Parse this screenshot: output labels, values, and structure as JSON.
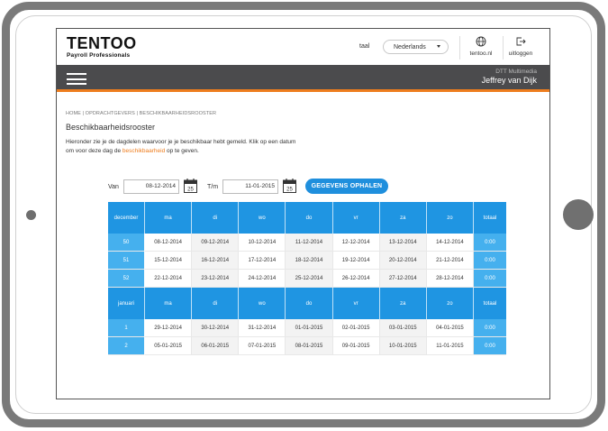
{
  "header": {
    "logo_main": "TENTOO",
    "logo_sub": "Payroll Professionals",
    "language_label": "taal",
    "language_value": "Nederlands",
    "site_link_label": "tentoo.nl",
    "logout_label": "uitloggen"
  },
  "navbar": {
    "company": "DTT Multimedia",
    "user": "Jeffrey van Dijk"
  },
  "breadcrumb": "HOME | OPDRACHTGEVERS | BESCHIKBAARHEIDSROOSTER",
  "page_title": "Beschikbaarheidsrooster",
  "intro": {
    "text_before": "Hieronder zie je de dagdelen waarvoor je je beschikbaar hebt gemeld. Klik op een datum om voor deze dag de ",
    "link": "beschikbaarheid",
    "text_after": " op te geven."
  },
  "filter": {
    "from_label": "Van",
    "from_value": "08-12-2014",
    "to_label": "T/m",
    "to_value": "11-01-2015",
    "calendar_day": "25",
    "fetch_button": "GEGEVENS OPHALEN"
  },
  "colors": {
    "accent_blue": "#1f95e2",
    "cell_blue": "#45b0ee",
    "orange": "#ee7d1e",
    "navbar": "#4b4b4d"
  },
  "months": [
    {
      "name": "december",
      "days": [
        "ma",
        "di",
        "wo",
        "do",
        "vr",
        "za",
        "zo"
      ],
      "total_label": "totaal",
      "weeks": [
        {
          "week": "50",
          "dates": [
            "08-12-2014",
            "09-12-2014",
            "10-12-2014",
            "11-12-2014",
            "12-12-2014",
            "13-12-2014",
            "14-12-2014"
          ],
          "total": "0:00"
        },
        {
          "week": "51",
          "dates": [
            "15-12-2014",
            "16-12-2014",
            "17-12-2014",
            "18-12-2014",
            "19-12-2014",
            "20-12-2014",
            "21-12-2014"
          ],
          "total": "0:00"
        },
        {
          "week": "52",
          "dates": [
            "22-12-2014",
            "23-12-2014",
            "24-12-2014",
            "25-12-2014",
            "26-12-2014",
            "27-12-2014",
            "28-12-2014"
          ],
          "total": "0:00"
        }
      ]
    },
    {
      "name": "januari",
      "days": [
        "ma",
        "di",
        "wo",
        "do",
        "vr",
        "za",
        "zo"
      ],
      "total_label": "totaal",
      "weeks": [
        {
          "week": "1",
          "dates": [
            "29-12-2014",
            "30-12-2014",
            "31-12-2014",
            "01-01-2015",
            "02-01-2015",
            "03-01-2015",
            "04-01-2015"
          ],
          "total": "0:00"
        },
        {
          "week": "2",
          "dates": [
            "05-01-2015",
            "06-01-2015",
            "07-01-2015",
            "08-01-2015",
            "09-01-2015",
            "10-01-2015",
            "11-01-2015"
          ],
          "total": "0:00"
        }
      ]
    }
  ]
}
